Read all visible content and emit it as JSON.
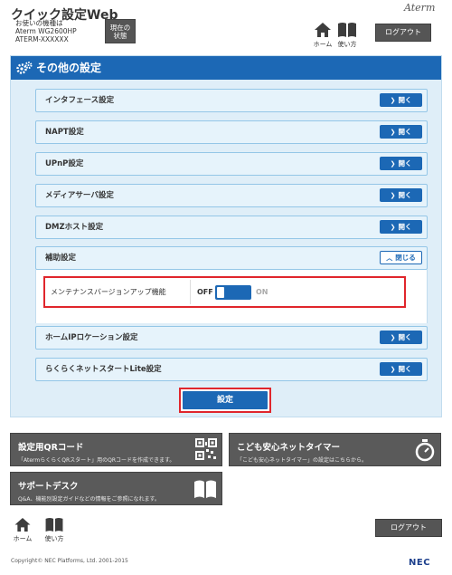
{
  "header": {
    "title": "クイック設定Web",
    "device_line1": "お使いの機種は",
    "device_line2": "Aterm WG2600HP",
    "device_line3": "ATERM-XXXXXX",
    "status_button_line1": "現在の",
    "status_button_line2": "状態",
    "brand": "Aterm",
    "home_label": "ホーム",
    "help_label": "使い方",
    "logout_label": "ログアウト"
  },
  "panel": {
    "title": "その他の設定",
    "open_label": "開く",
    "close_label": "閉じる",
    "rows": [
      {
        "label": "インタフェース設定"
      },
      {
        "label": "NAPT設定"
      },
      {
        "label": "UPnP設定"
      },
      {
        "label": "メディアサーバ設定"
      },
      {
        "label": "DMZホスト設定"
      },
      {
        "label": "補助設定"
      },
      {
        "label": "ホームIPロケーション設定"
      },
      {
        "label": "らくらくネットスタートLite設定"
      }
    ],
    "maintenance": {
      "label": "メンテナンスバージョンアップ機能",
      "off_label": "OFF",
      "on_label": "ON",
      "state": "OFF"
    },
    "submit_label": "設定"
  },
  "tiles": {
    "qr": {
      "title": "設定用QRコード",
      "desc": "「AtermらくらくQRスタート」用のQRコードを作成できます。"
    },
    "timer": {
      "title": "こども安心ネットタイマー",
      "desc": "「こども安心ネットタイマー」の設定はこちらから。"
    },
    "support": {
      "title": "サポートデスク",
      "desc": "Q&A、機能別設定ガイドなどの情報をご参照になれます。"
    }
  },
  "footer": {
    "home_label": "ホーム",
    "help_label": "使い方",
    "logout_label": "ログアウト",
    "copyright": "Copyright© NEC Platforms, Ltd. 2001-2015",
    "brand": "NEC"
  },
  "colors": {
    "accent": "#1c68b5",
    "panel_bg": "#dfeef8",
    "highlight": "#e0262c",
    "tile_bg": "#5a5a5a"
  }
}
